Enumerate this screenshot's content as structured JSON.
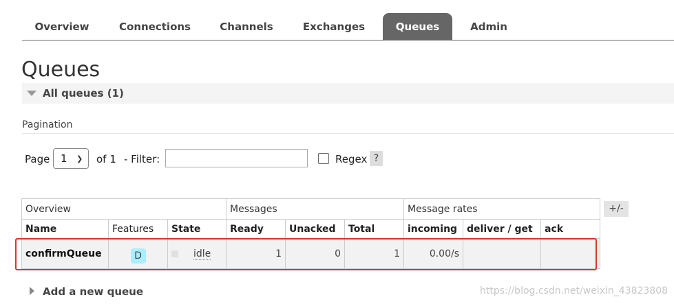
{
  "tabs": [
    {
      "label": "Overview",
      "active": false
    },
    {
      "label": "Connections",
      "active": false
    },
    {
      "label": "Channels",
      "active": false
    },
    {
      "label": "Exchanges",
      "active": false
    },
    {
      "label": "Queues",
      "active": true
    },
    {
      "label": "Admin",
      "active": false
    }
  ],
  "page_title": "Queues",
  "section": {
    "label": "All queues (1)"
  },
  "pagination": {
    "label": "Pagination",
    "page_label": "Page",
    "page_value": "1",
    "of_label": "of 1",
    "filter_label": "- Filter:",
    "filter_value": "",
    "regex_label": "Regex",
    "help_label": "?"
  },
  "table": {
    "groups": [
      "Overview",
      "Messages",
      "Message rates"
    ],
    "columns": [
      "Name",
      "Features",
      "State",
      "Ready",
      "Unacked",
      "Total",
      "incoming",
      "deliver / get",
      "ack"
    ],
    "rows": [
      {
        "name": "confirmQueue",
        "feature": "D",
        "state": "idle",
        "ready": "1",
        "unacked": "0",
        "total": "1",
        "incoming": "0.00/s",
        "deliver_get": "",
        "ack": ""
      }
    ],
    "toggle_label": "+/-"
  },
  "add_queue_label": "Add a new queue",
  "watermark": "https://blog.csdn.net/weixin_43823808",
  "colors": {
    "active_tab": "#666666",
    "feature_badge": "#aaeeff",
    "highlight_border": "#d8342f"
  }
}
